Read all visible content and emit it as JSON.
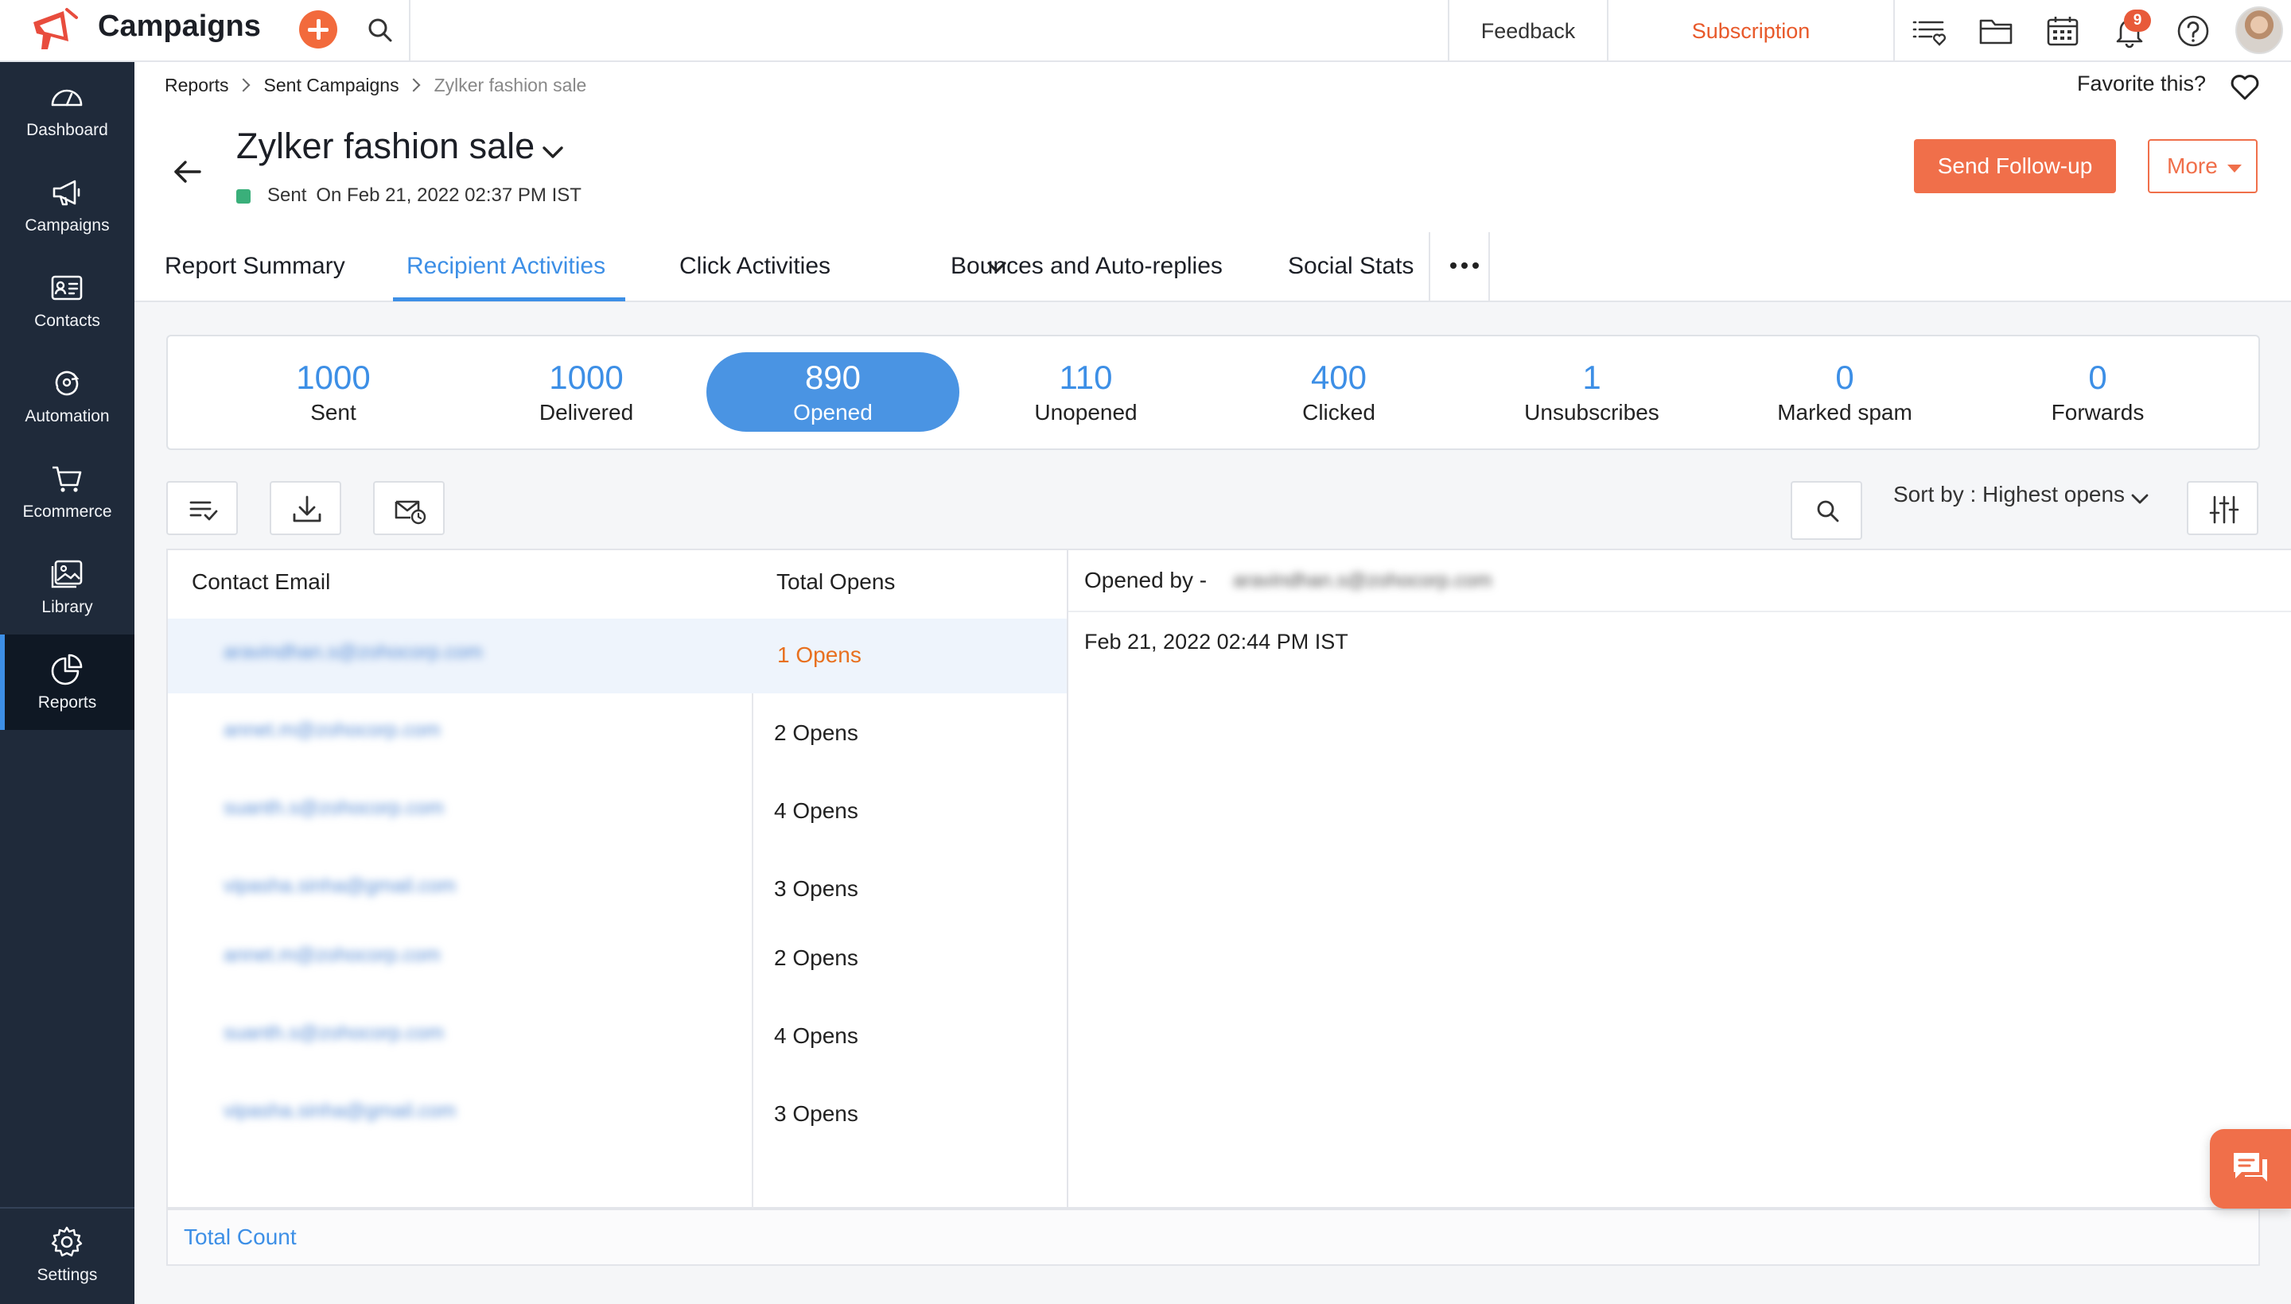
{
  "app": {
    "title": "Campaigns"
  },
  "topbar": {
    "feedback": "Feedback",
    "subscription": "Subscription",
    "notification_count": "9"
  },
  "sidebar": {
    "items": [
      {
        "label": "Dashboard",
        "icon": "dashboard-icon"
      },
      {
        "label": "Campaigns",
        "icon": "megaphone-icon"
      },
      {
        "label": "Contacts",
        "icon": "contact-card-icon"
      },
      {
        "label": "Automation",
        "icon": "automation-icon"
      },
      {
        "label": "Ecommerce",
        "icon": "cart-icon"
      },
      {
        "label": "Library",
        "icon": "image-library-icon"
      },
      {
        "label": "Reports",
        "icon": "pie-chart-icon"
      }
    ],
    "settings": "Settings",
    "active": "Reports"
  },
  "breadcrumb": [
    "Reports",
    "Sent Campaigns",
    "Zylker fashion sale"
  ],
  "favorite": "Favorite this?",
  "campaign": {
    "title": "Zylker fashion sale",
    "status": "Sent",
    "sent_on": "On Feb 21, 2022 02:37 PM IST"
  },
  "actions": {
    "follow_up": "Send Follow-up",
    "more": "More"
  },
  "tabs": [
    {
      "label": "Report Summary"
    },
    {
      "label": "Recipient Activities"
    },
    {
      "label": "Click Activities"
    },
    {
      "label": "Bounces and Auto-replies"
    },
    {
      "label": "Social Stats"
    }
  ],
  "active_tab": "Recipient Activities",
  "stats": [
    {
      "value": "1000",
      "label": "Sent"
    },
    {
      "value": "1000",
      "label": "Delivered"
    },
    {
      "value": "890",
      "label": "Opened"
    },
    {
      "value": "110",
      "label": "Unopened"
    },
    {
      "value": "400",
      "label": "Clicked"
    },
    {
      "value": "1",
      "label": "Unsubscribes"
    },
    {
      "value": "0",
      "label": "Marked spam"
    },
    {
      "value": "0",
      "label": "Forwards"
    }
  ],
  "active_stat": "Opened",
  "sort": {
    "label": "Sort by : Highest opens"
  },
  "table": {
    "headers": {
      "email": "Contact Email",
      "opens": "Total Opens"
    },
    "rows": [
      {
        "email": "aravindhan.s@zohocorp.com",
        "opens": "1 Opens"
      },
      {
        "email": "annet.m@zohocorp.com",
        "opens": "2 Opens"
      },
      {
        "email": "suanth.s@zohocorp.com",
        "opens": "4 Opens"
      },
      {
        "email": "vipasha.sinha@gmail.com",
        "opens": "3 Opens"
      },
      {
        "email": "annet.m@zohocorp.com",
        "opens": "2 Opens"
      },
      {
        "email": "suanth.s@zohocorp.com",
        "opens": "4 Opens"
      },
      {
        "email": "vipasha.sinha@gmail.com",
        "opens": "3 Opens"
      }
    ],
    "footer": "Total Count"
  },
  "opened_by": {
    "label": "Opened by  -",
    "email": "aravindhan.s@zohocorp.com",
    "time": "Feb 21, 2022 02:44 PM IST"
  },
  "colors": {
    "accent": "#3d8fe6",
    "brand": "#f06f4a",
    "sidebar": "#1f2a3a",
    "sent_status": "#3aaf7a"
  }
}
